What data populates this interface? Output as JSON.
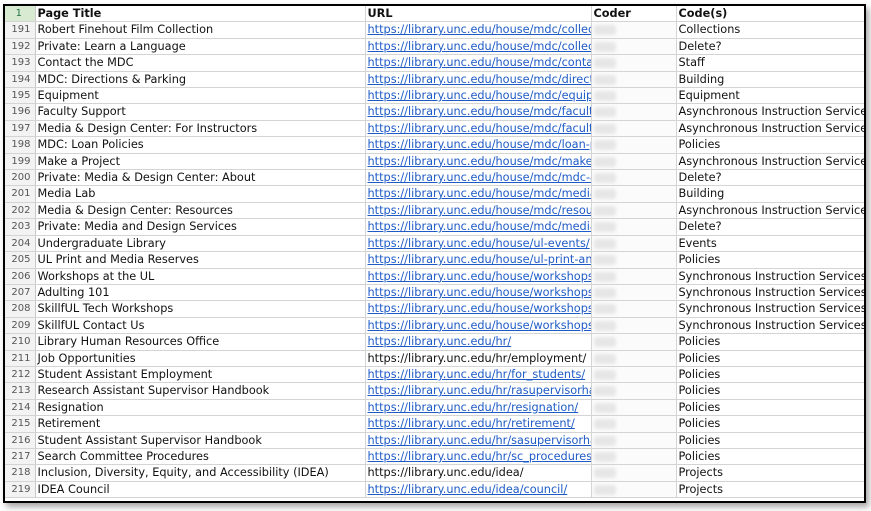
{
  "header": {
    "row_number": "1",
    "col_title": "Page Title",
    "col_url": "URL",
    "col_coder": "Coder",
    "col_codes": "Code(s)"
  },
  "rows": [
    {
      "n": "191",
      "title": "Robert Finehout Film Collection",
      "url": "https://library.unc.edu/house/mdc/collectio",
      "link": true,
      "code": "Collections"
    },
    {
      "n": "192",
      "title": "Private: Learn a Language",
      "url": "https://library.unc.edu/house/mdc/collectio",
      "link": true,
      "code": "Delete?"
    },
    {
      "n": "193",
      "title": "Contact the MDC",
      "url": "https://library.unc.edu/house/mdc/contact/",
      "link": true,
      "code": "Staff"
    },
    {
      "n": "194",
      "title": "MDC: Directions & Parking",
      "url": "https://library.unc.edu/house/mdc/direction",
      "link": true,
      "code": "Building"
    },
    {
      "n": "195",
      "title": "Equipment",
      "url": "https://library.unc.edu/house/mdc/equipme",
      "link": true,
      "code": "Equipment"
    },
    {
      "n": "196",
      "title": "Faculty Support",
      "url": "https://library.unc.edu/house/mdc/faculty-s",
      "link": true,
      "code": "Asynchronous Instruction Services"
    },
    {
      "n": "197",
      "title": "Media & Design Center: For Instructors",
      "url": "https://library.unc.edu/house/mdc/faculty/",
      "link": true,
      "code": "Asynchronous Instruction Services"
    },
    {
      "n": "198",
      "title": "MDC: Loan Policies",
      "url": "https://library.unc.edu/house/mdc/loan-pol",
      "link": true,
      "code": "Policies"
    },
    {
      "n": "199",
      "title": "Make a Project",
      "url": "https://library.unc.edu/house/mdc/make-a-",
      "link": true,
      "code": "Asynchronous Instruction Services"
    },
    {
      "n": "200",
      "title": "Private: Media & Design Center: About",
      "url": "https://library.unc.edu/house/mdc/mdc-abo",
      "link": true,
      "code": "Delete?"
    },
    {
      "n": "201",
      "title": "Media Lab",
      "url": "https://library.unc.edu/house/mdc/media-la",
      "link": true,
      "code": "Building"
    },
    {
      "n": "202",
      "title": "Media & Design Center: Resources",
      "url": "https://library.unc.edu/house/mdc/resource",
      "link": true,
      "code": "Asynchronous Instruction Services"
    },
    {
      "n": "203",
      "title": "Private: Media and Design Services",
      "url": "https://library.unc.edu/house/mdc/media-and-de",
      "link": true,
      "code": "Delete?"
    },
    {
      "n": "204",
      "title": "Undergraduate Library",
      "url": "https://library.unc.edu/house/ul-events/",
      "link": true,
      "code": "Events"
    },
    {
      "n": "205",
      "title": "UL Print and Media Reserves",
      "url": "https://library.unc.edu/house/ul-print-and-m",
      "link": true,
      "code": "Policies"
    },
    {
      "n": "206",
      "title": "Workshops at the UL",
      "url": "https://library.unc.edu/house/workshops/",
      "link": true,
      "code": "Synchronous Instruction Services"
    },
    {
      "n": "207",
      "title": "Adulting 101",
      "url": "https://library.unc.edu/house/workshops/ad",
      "link": true,
      "code": "Synchronous Instruction Services"
    },
    {
      "n": "208",
      "title": "SkillfUL Tech Workshops",
      "url": "https://library.unc.edu/house/workshops/sk",
      "link": true,
      "code": "Synchronous Instruction Services"
    },
    {
      "n": "209",
      "title": "SkillfUL Contact Us",
      "url": "https://library.unc.edu/house/workshops/sk",
      "link": true,
      "code": "Synchronous Instruction Services"
    },
    {
      "n": "210",
      "title": "Library Human Resources Office",
      "url": "https://library.unc.edu/hr/",
      "link": true,
      "code": "Policies"
    },
    {
      "n": "211",
      "title": "Job Opportunities",
      "url": "https://library.unc.edu/hr/employment/",
      "link": false,
      "code": "Policies"
    },
    {
      "n": "212",
      "title": "Student Assistant Employment",
      "url": "https://library.unc.edu/hr/for_students/",
      "link": true,
      "code": "Policies"
    },
    {
      "n": "213",
      "title": "Research Assistant Supervisor Handbook",
      "url": "https://library.unc.edu/hr/rasupervisorhand",
      "link": true,
      "code": "Policies"
    },
    {
      "n": "214",
      "title": "Resignation",
      "url": "https://library.unc.edu/hr/resignation/",
      "link": true,
      "code": "Policies"
    },
    {
      "n": "215",
      "title": "Retirement",
      "url": "https://library.unc.edu/hr/retirement/",
      "link": true,
      "code": "Policies"
    },
    {
      "n": "216",
      "title": "Student Assistant Supervisor Handbook",
      "url": "https://library.unc.edu/hr/sasupervisorhand",
      "link": true,
      "code": "Policies"
    },
    {
      "n": "217",
      "title": "Search Committee Procedures",
      "url": "https://library.unc.edu/hr/sc_procedures/",
      "link": true,
      "code": "Policies"
    },
    {
      "n": "218",
      "title": "Inclusion, Diversity, Equity, and Accessibility (IDEA)",
      "url": "https://library.unc.edu/idea/",
      "link": false,
      "code": "Projects"
    },
    {
      "n": "219",
      "title": "IDEA Council",
      "url": "https://library.unc.edu/idea/council/",
      "link": true,
      "code": "Projects"
    }
  ],
  "colors": {
    "link": "#1e5bc6",
    "header_row_number_bg": "#d9ead3",
    "grid": "#d4d4d4"
  }
}
